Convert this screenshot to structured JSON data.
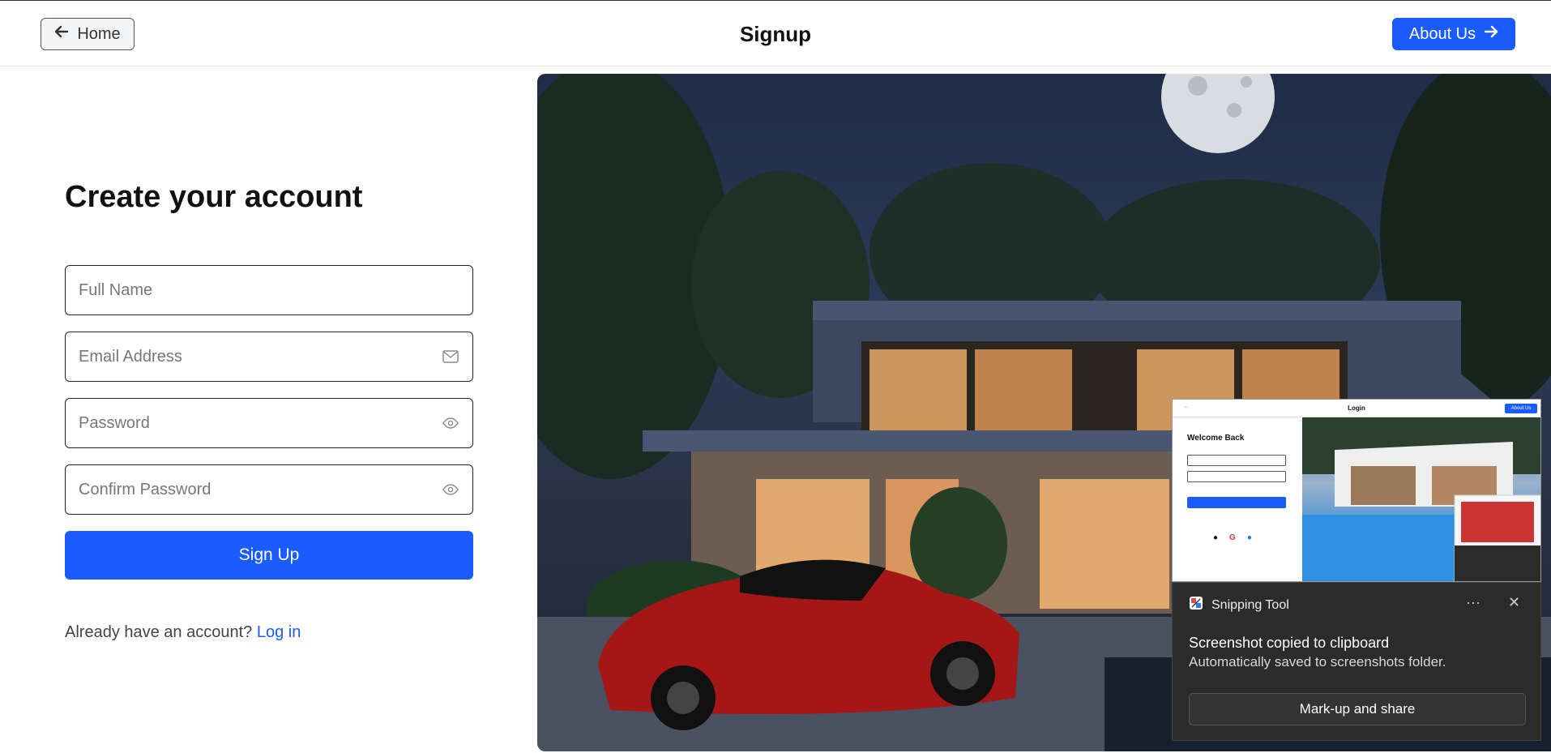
{
  "header": {
    "home_label": "Home",
    "title": "Signup",
    "about_label": "About Us"
  },
  "form": {
    "title": "Create your account",
    "full_name_placeholder": "Full Name",
    "email_placeholder": "Email Address",
    "password_placeholder": "Password",
    "confirm_password_placeholder": "Confirm Password",
    "submit_label": "Sign Up",
    "login_prompt": "Already have an account?",
    "login_link": "Log in"
  },
  "snipping_tool": {
    "app_name": "Snipping Tool",
    "more_label": "···",
    "close_label": "✕",
    "message_title": "Screenshot copied to clipboard",
    "message_sub": "Automatically saved to screenshots folder.",
    "action_label": "Mark-up and share",
    "thumbnail": {
      "title": "Login",
      "form_title": "Welcome Back",
      "about_label": "About Us"
    }
  },
  "colors": {
    "accent": "#1a5cff",
    "toast_bg": "#2b2b2b"
  }
}
